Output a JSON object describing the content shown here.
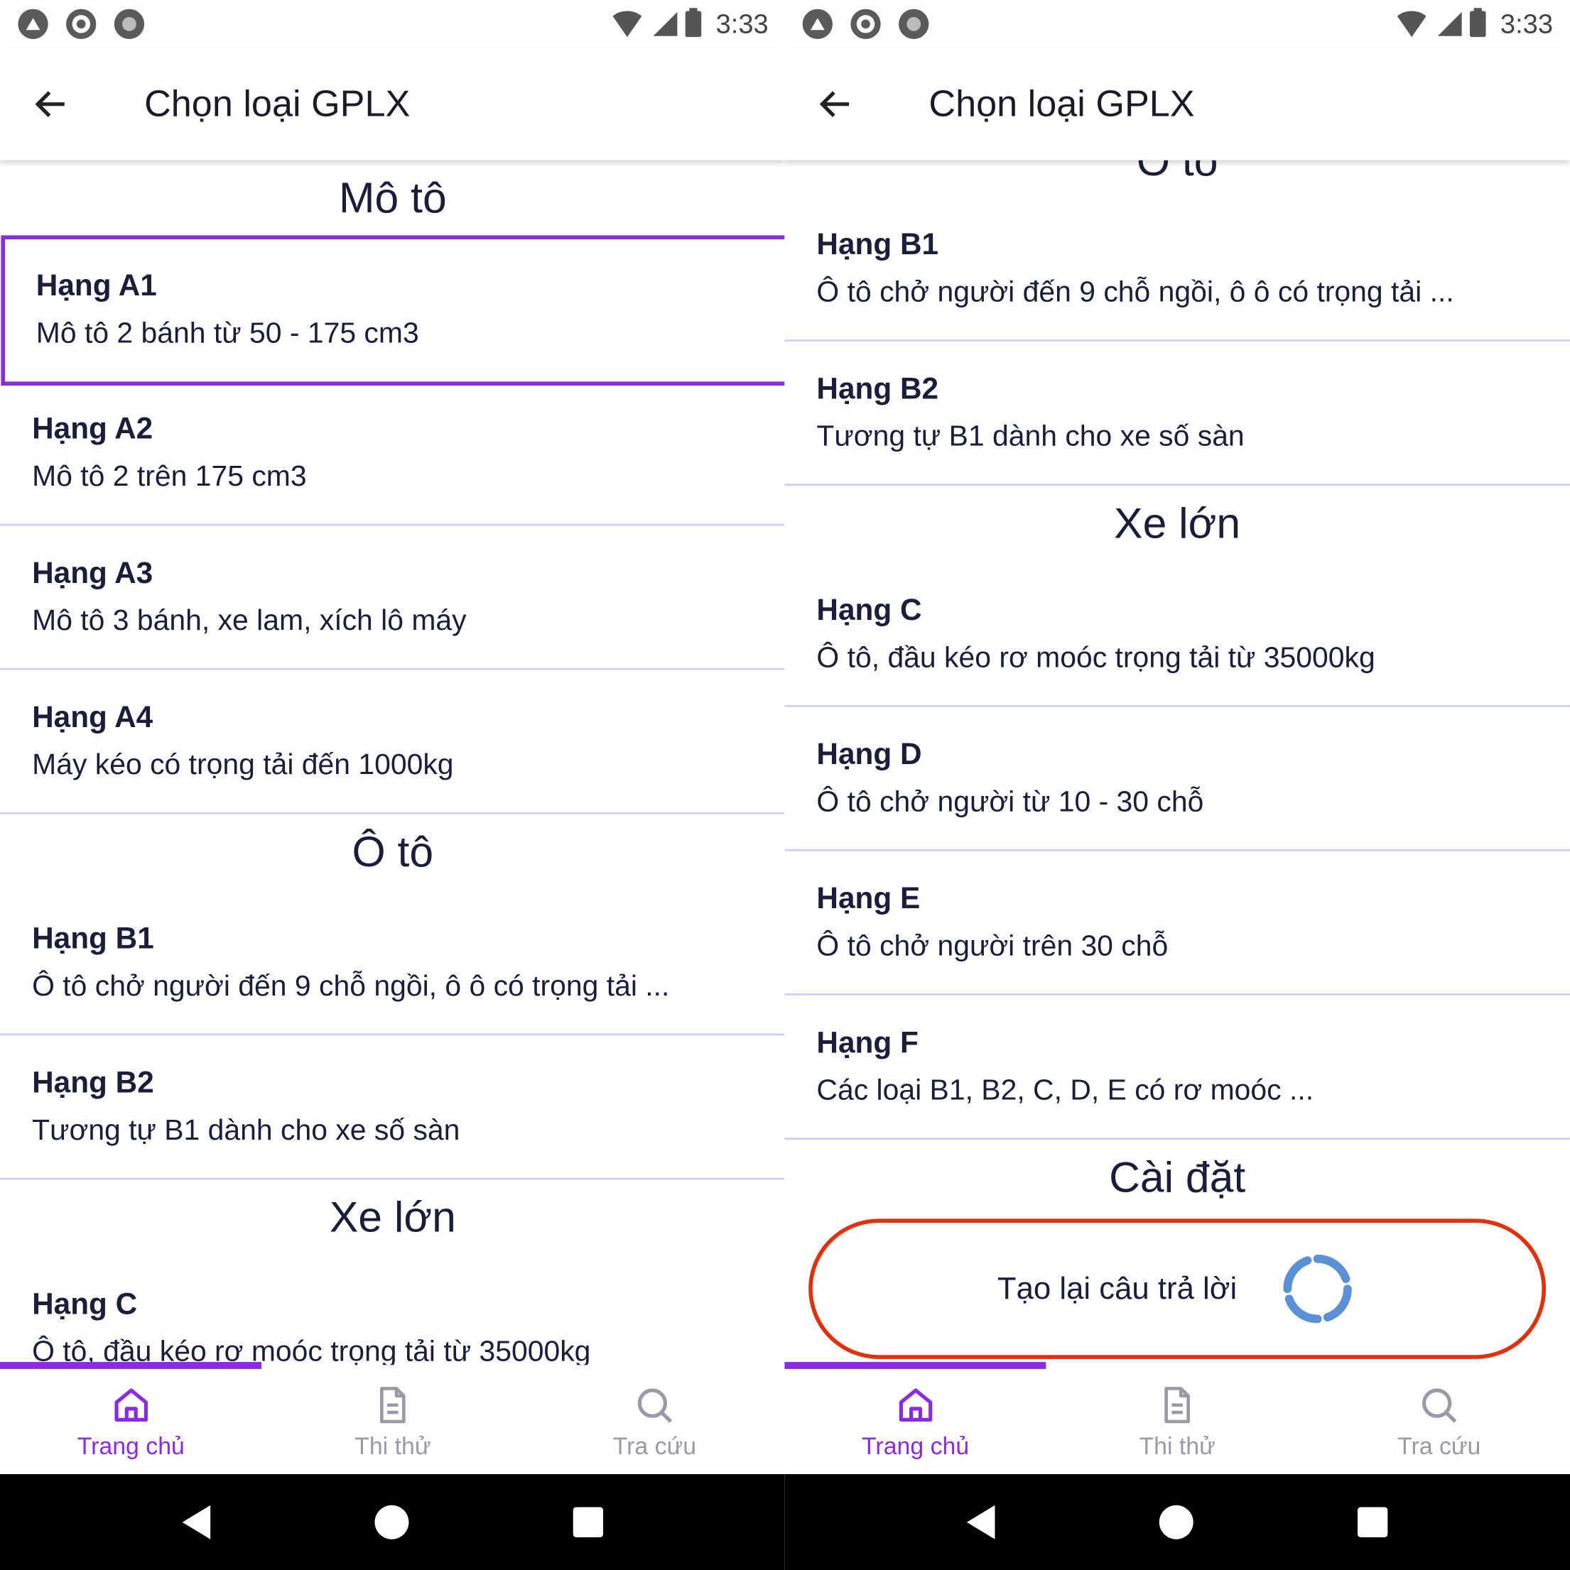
{
  "status": {
    "time": "3:33"
  },
  "appbar": {
    "title": "Chọn loại GPLX"
  },
  "sections": {
    "moto": "Mô tô",
    "oto": "Ô tô",
    "xelon": "Xe lớn",
    "caidat": "Cài đặt"
  },
  "items": {
    "a1": {
      "title": "Hạng A1",
      "desc": "Mô tô 2 bánh từ 50 - 175 cm3"
    },
    "a2": {
      "title": "Hạng A2",
      "desc": "Mô tô 2 trên 175 cm3"
    },
    "a3": {
      "title": "Hạng A3",
      "desc": "Mô tô 3 bánh, xe lam, xích lô máy"
    },
    "a4": {
      "title": "Hạng A4",
      "desc": "Máy kéo có trọng tải đến 1000kg"
    },
    "b1": {
      "title": "Hạng B1",
      "desc": "Ô tô chở người đến 9 chỗ ngồi, ô ô có trọng tải ..."
    },
    "b2": {
      "title": "Hạng B2",
      "desc": "Tương tự B1 dành cho xe số sàn"
    },
    "c": {
      "title": "Hạng C",
      "desc": "Ô tô, đầu kéo rơ moóc trọng tải từ 35000kg"
    },
    "d": {
      "title": "Hạng D",
      "desc": "Ô tô chở người từ 10 - 30 chỗ"
    },
    "e": {
      "title": "Hạng E",
      "desc": "Ô tô chở người trên 30 chỗ"
    },
    "f": {
      "title": "Hạng F",
      "desc": "Các loại B1, B2, C, D, E có rơ moóc ..."
    }
  },
  "settings": {
    "reset_label": "Tạo lại câu trả lời"
  },
  "bottom_nav": {
    "home": "Trang chủ",
    "test": "Thi thử",
    "lookup": "Tra cứu"
  },
  "colors": {
    "accent": "#8a2be2",
    "divider": "#cfd0f6",
    "text": "#1c1d3a",
    "inactive": "#9a9aa6",
    "highlight": "#e0300c",
    "refresh": "#5b8fd6"
  },
  "icons": [
    "arrow-left-icon",
    "home-icon",
    "document-icon",
    "search-icon",
    "refresh-icon"
  ]
}
